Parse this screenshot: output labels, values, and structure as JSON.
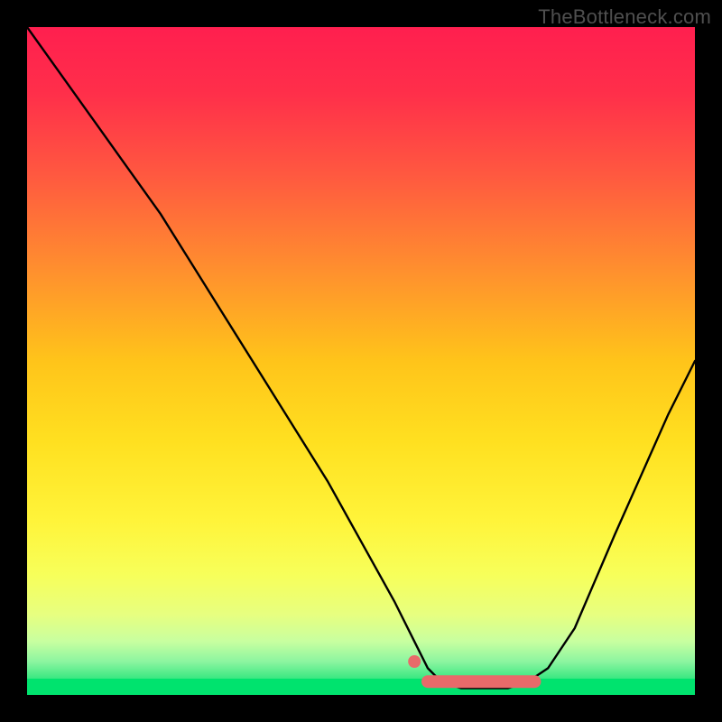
{
  "attribution": "TheBottleneck.com",
  "colors": {
    "frame": "#000000",
    "attribution_text": "#4f4f4f",
    "curve": "#000000",
    "marker": "#e86a6a",
    "gradient_stops": [
      {
        "offset": 0.0,
        "color": "#ff1f4f"
      },
      {
        "offset": 0.1,
        "color": "#ff2f4a"
      },
      {
        "offset": 0.22,
        "color": "#ff5840"
      },
      {
        "offset": 0.35,
        "color": "#ff8a30"
      },
      {
        "offset": 0.5,
        "color": "#ffc41a"
      },
      {
        "offset": 0.62,
        "color": "#ffe020"
      },
      {
        "offset": 0.74,
        "color": "#fff43a"
      },
      {
        "offset": 0.82,
        "color": "#f7ff5a"
      },
      {
        "offset": 0.88,
        "color": "#e7ff80"
      },
      {
        "offset": 0.92,
        "color": "#c8ffa0"
      },
      {
        "offset": 0.95,
        "color": "#8cf5a0"
      },
      {
        "offset": 0.975,
        "color": "#3ce882"
      },
      {
        "offset": 1.0,
        "color": "#00e36e"
      }
    ]
  },
  "chart_data": {
    "type": "line",
    "title": "",
    "xlabel": "",
    "ylabel": "",
    "xlim": [
      0,
      100
    ],
    "ylim": [
      0,
      100
    ],
    "grid": false,
    "series": [
      {
        "name": "bottleneck-curve",
        "x": [
          0,
          5,
          10,
          15,
          20,
          25,
          30,
          35,
          40,
          45,
          50,
          55,
          58,
          60,
          62,
          65,
          68,
          72,
          75,
          78,
          82,
          85,
          88,
          92,
          96,
          100
        ],
        "y": [
          100,
          93,
          86,
          79,
          72,
          64,
          56,
          48,
          40,
          32,
          23,
          14,
          8,
          4,
          2,
          1,
          1,
          1,
          2,
          4,
          10,
          17,
          24,
          33,
          42,
          50
        ]
      }
    ],
    "markers": [
      {
        "name": "highlight-dot",
        "x": 58,
        "y": 5
      },
      {
        "name": "highlight-band-start",
        "x": 60,
        "y": 2
      },
      {
        "name": "highlight-band-end",
        "x": 76,
        "y": 2
      }
    ]
  }
}
